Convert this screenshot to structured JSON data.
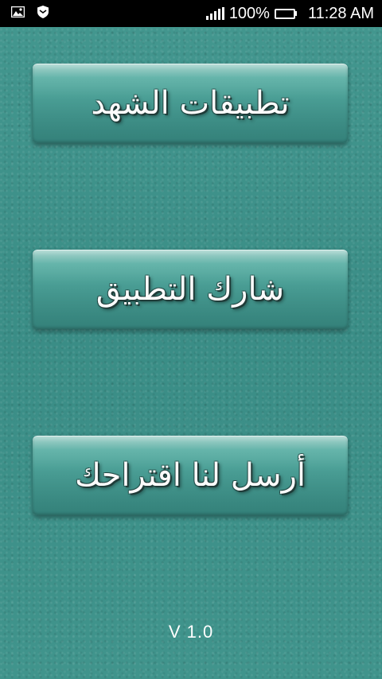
{
  "status_bar": {
    "battery_percent_text": "100%",
    "time": "11:28 AM",
    "battery_level": 1.0,
    "icons": [
      "image-icon",
      "shield-icon",
      "signal-icon",
      "battery-icon"
    ]
  },
  "menu": {
    "apps_label": "تطبيقات الشهد",
    "share_label": "شارك التطبيق",
    "suggest_label": "أرسل لنا اقتراحك"
  },
  "footer": {
    "version": "V 1.0"
  },
  "colors": {
    "background": "#3e918a",
    "button": "#4a9e95",
    "text": "#fbfbfb"
  }
}
